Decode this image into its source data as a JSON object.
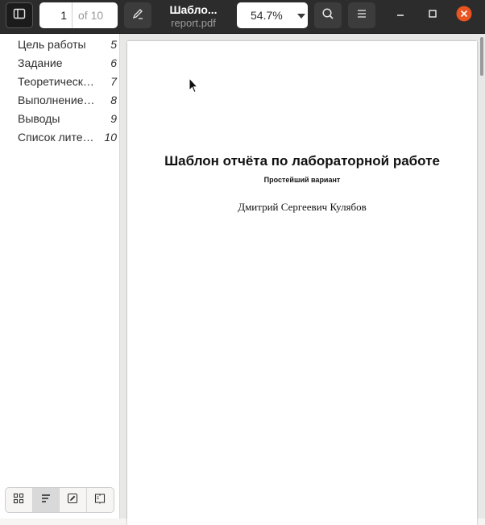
{
  "header": {
    "sidebar_toggle_icon": "sidebar-show-icon",
    "page_number": "1",
    "page_total": "of 10",
    "annotate_icon": "pencil-icon",
    "doc_title": "Шабло...",
    "doc_filename": "report.pdf",
    "zoom_value": "54.7%",
    "zoom_dropdown_icon": "caret-down-icon",
    "search_icon": "search-icon",
    "menu_icon": "hamburger-icon",
    "minimize_icon": "minimize-icon",
    "maximize_icon": "maximize-icon",
    "close_icon": "close-icon",
    "close_color": "#e95420"
  },
  "sidebar": {
    "outline": [
      {
        "label": "Цель работы",
        "page": "5"
      },
      {
        "label": "Задание",
        "page": "6"
      },
      {
        "label": "Теоретические сведения",
        "page": "7"
      },
      {
        "label": "Выполнение лабораторной работы",
        "page": "8"
      },
      {
        "label": "Выводы",
        "page": "9"
      },
      {
        "label": "Список литературы",
        "page": "10"
      }
    ],
    "tools": [
      {
        "icon": "thumbnails-grid-icon"
      },
      {
        "icon": "outline-list-icon",
        "active": true
      },
      {
        "icon": "annotations-icon"
      },
      {
        "icon": "bookmarks-icon"
      }
    ]
  },
  "document": {
    "title": "Шаблон отчёта по лабораторной работе",
    "subtitle": "Простейший вариант",
    "author": "Дмитрий Сергеевич Кулябов"
  }
}
